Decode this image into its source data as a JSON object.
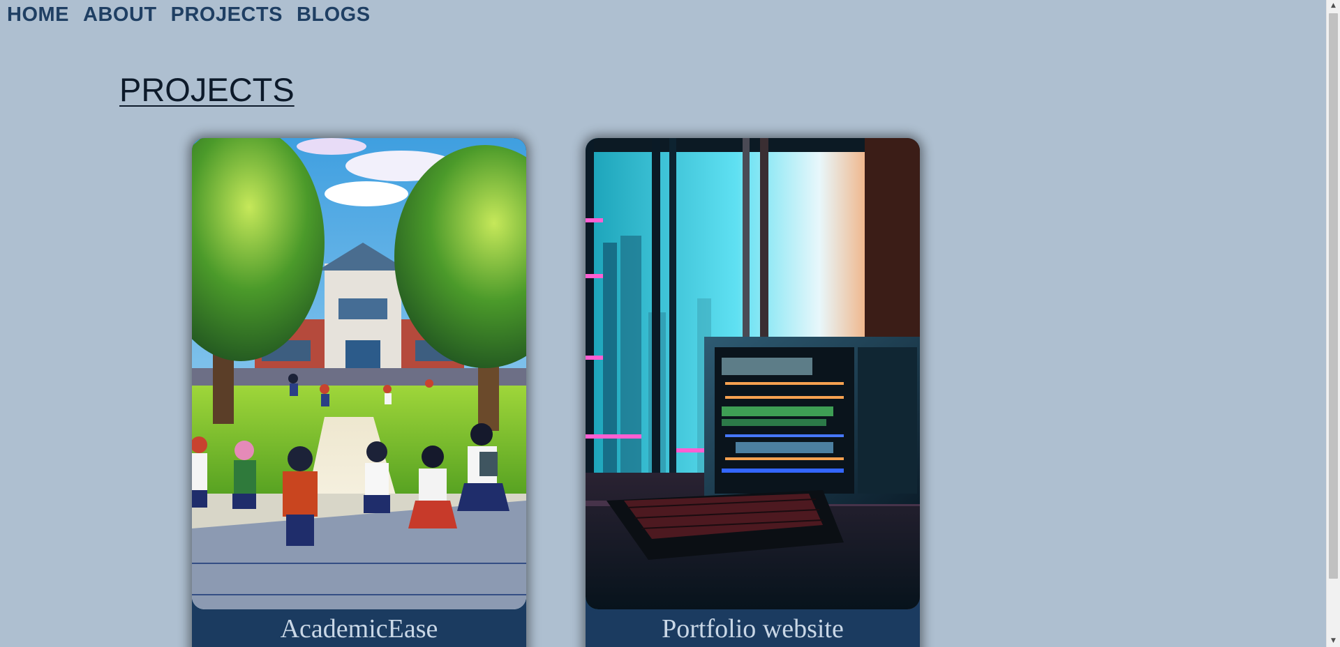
{
  "nav": {
    "items": [
      {
        "label": "HOME"
      },
      {
        "label": "ABOUT"
      },
      {
        "label": "PROJECTS"
      },
      {
        "label": "BLOGS"
      }
    ]
  },
  "projects": {
    "heading": "PROJECTS",
    "cards": [
      {
        "title": "AcademicEase",
        "image": "anime-schoolchildren-illustration"
      },
      {
        "title": "Portfolio website",
        "image": "neon-computer-tower-illustration"
      }
    ]
  },
  "scrollbar": {
    "up_icon": "chevron-up-icon",
    "down_icon": "chevron-down-icon"
  },
  "colors": {
    "page_background": "#aebfd0",
    "nav_text": "#1f3f63",
    "card_footer": "#1b3b60",
    "card_title_text": "#c9d7e6"
  }
}
